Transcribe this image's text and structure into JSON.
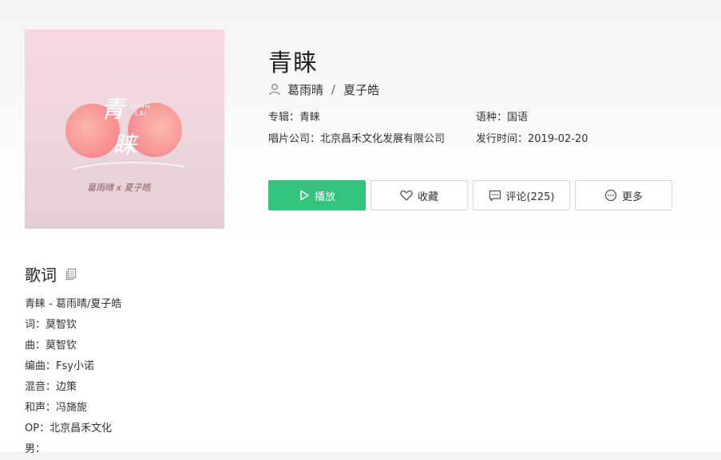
{
  "cover": {
    "title_art": "青睐",
    "pinyin": "QING LAI",
    "artists_art": "葛雨晴 × 夏子皓"
  },
  "song": {
    "title": "青睐",
    "artists": [
      "葛雨晴",
      "夏子皓"
    ],
    "separator": "/"
  },
  "meta": {
    "album_label": "专辑：",
    "album": "青睐",
    "language_label": "语种：",
    "language": "国语",
    "company_label": "唱片公司：",
    "company": "北京昌禾文化发展有限公司",
    "release_label": "发行时间：",
    "release": "2019-02-20"
  },
  "actions": {
    "play": "播放",
    "favorite": "收藏",
    "comments": "评论(225)",
    "more": "更多"
  },
  "lyrics": {
    "heading": "歌词",
    "lines": [
      "青睐 - 葛雨晴/夏子皓",
      "词：莫智钦",
      "曲：莫智钦",
      "编曲：Fsy小诺",
      "混音：边策",
      "和声：冯旖旎",
      "OP：北京昌禾文化",
      "男："
    ]
  },
  "colors": {
    "accent": "#31c27c",
    "cover_bg": "#f3d6de",
    "circle": "#f79a9a"
  }
}
